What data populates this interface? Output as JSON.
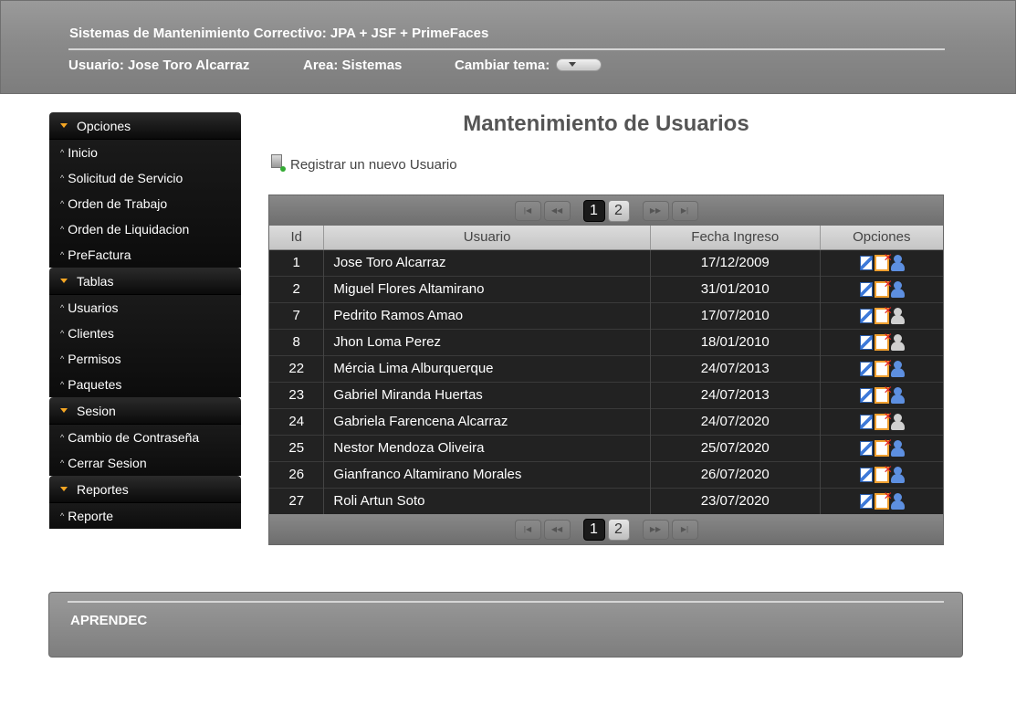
{
  "header": {
    "title": "Sistemas de Mantenimiento Correctivo: JPA + JSF + PrimeFaces",
    "user": "Usuario: Jose Toro Alcarraz",
    "area": "Area: Sistemas",
    "theme_label": "Cambiar tema:"
  },
  "sidebar": {
    "groups": [
      {
        "label": "Opciones",
        "items": [
          {
            "label": "Inicio"
          },
          {
            "label": "Solicitud de Servicio"
          },
          {
            "label": "Orden de Trabajo"
          },
          {
            "label": "Orden de Liquidacion"
          },
          {
            "label": "PreFactura"
          }
        ]
      },
      {
        "label": "Tablas",
        "items": [
          {
            "label": "Usuarios"
          },
          {
            "label": "Clientes"
          },
          {
            "label": "Permisos"
          },
          {
            "label": "Paquetes"
          }
        ]
      },
      {
        "label": "Sesion",
        "items": [
          {
            "label": "Cambio de Contraseña"
          },
          {
            "label": "Cerrar Sesion"
          }
        ]
      },
      {
        "label": "Reportes",
        "items": [
          {
            "label": "Reporte"
          }
        ]
      }
    ]
  },
  "main": {
    "title": "Mantenimiento de Usuarios",
    "new_user_link": "Registrar un nuevo Usuario",
    "paginator": {
      "pages": [
        "1",
        "2"
      ],
      "current": "1"
    },
    "columns": [
      "Id",
      "Usuario",
      "Fecha Ingreso",
      "Opciones"
    ],
    "rows": [
      {
        "id": "1",
        "usuario": "Jose Toro Alcarraz",
        "fecha": "17/12/2009",
        "user_icon": "blue"
      },
      {
        "id": "2",
        "usuario": "Miguel Flores Altamirano",
        "fecha": "31/01/2010",
        "user_icon": "blue"
      },
      {
        "id": "7",
        "usuario": "Pedrito Ramos Amao",
        "fecha": "17/07/2010",
        "user_icon": "gray"
      },
      {
        "id": "8",
        "usuario": "Jhon Loma Perez",
        "fecha": "18/01/2010",
        "user_icon": "gray"
      },
      {
        "id": "22",
        "usuario": "Mércia Lima Alburquerque",
        "fecha": "24/07/2013",
        "user_icon": "blue"
      },
      {
        "id": "23",
        "usuario": "Gabriel Miranda Huertas",
        "fecha": "24/07/2013",
        "user_icon": "blue"
      },
      {
        "id": "24",
        "usuario": "Gabriela Farencena Alcarraz",
        "fecha": "24/07/2020",
        "user_icon": "gray"
      },
      {
        "id": "25",
        "usuario": "Nestor Mendoza Oliveira",
        "fecha": "25/07/2020",
        "user_icon": "blue"
      },
      {
        "id": "26",
        "usuario": "Gianfranco Altamirano Morales",
        "fecha": "26/07/2020",
        "user_icon": "blue"
      },
      {
        "id": "27",
        "usuario": "Roli Artun Soto",
        "fecha": "23/07/2020",
        "user_icon": "blue"
      }
    ]
  },
  "footer": {
    "text": "APRENDEC"
  }
}
